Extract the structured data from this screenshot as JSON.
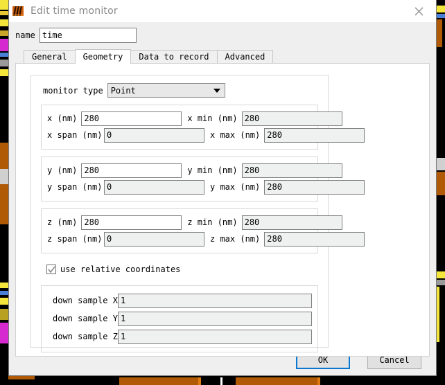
{
  "window": {
    "title": "Edit time monitor",
    "app_icon": "lumerical-flame-icon",
    "close_icon": "close-icon"
  },
  "name_field": {
    "label": "name",
    "value": "time",
    "placeholder": ""
  },
  "tabs": [
    {
      "label": "General",
      "active": false
    },
    {
      "label": "Geometry",
      "active": true
    },
    {
      "label": "Data to record",
      "active": false
    },
    {
      "label": "Advanced",
      "active": false
    }
  ],
  "monitor_type": {
    "label": "monitor type",
    "value": "Point",
    "caret_icon": "chevron-down-icon"
  },
  "axes": [
    {
      "id": "x",
      "pos_label": "x (nm)",
      "pos_value": "280",
      "pos_enabled": true,
      "span_label": "x span (nm)",
      "span_value": "0",
      "span_enabled": false,
      "min_label": "x min (nm)",
      "min_value": "280",
      "min_enabled": false,
      "max_label": "x max (nm)",
      "max_value": "280",
      "max_enabled": false
    },
    {
      "id": "y",
      "pos_label": "y (nm)",
      "pos_value": "280",
      "pos_enabled": true,
      "span_label": "y span (nm)",
      "span_value": "0",
      "span_enabled": false,
      "min_label": "y min (nm)",
      "min_value": "280",
      "min_enabled": false,
      "max_label": "y max (nm)",
      "max_value": "280",
      "max_enabled": false
    },
    {
      "id": "z",
      "pos_label": "z (nm)",
      "pos_value": "280",
      "pos_enabled": true,
      "span_label": "z span (nm)",
      "span_value": "0",
      "span_enabled": false,
      "min_label": "z min (nm)",
      "min_value": "280",
      "min_enabled": false,
      "max_label": "z max (nm)",
      "max_value": "280",
      "max_enabled": false
    }
  ],
  "relative_coordinates": {
    "label": "use relative coordinates",
    "checked": true,
    "check_icon": "checkmark-icon"
  },
  "down_sample": [
    {
      "label": "down sample X",
      "value": "1"
    },
    {
      "label": "down sample Y",
      "value": "1"
    },
    {
      "label": "down sample Z",
      "value": "1"
    }
  ],
  "footer": {
    "ok_label": "OK",
    "cancel_label": "Cancel"
  },
  "colors": {
    "focus_blue": "#0a78d1",
    "panel_bg": "#efefef",
    "disabled_field": "#eff0f0",
    "enabled_field": "#ffffff",
    "title_text": "#8a8a8a"
  }
}
